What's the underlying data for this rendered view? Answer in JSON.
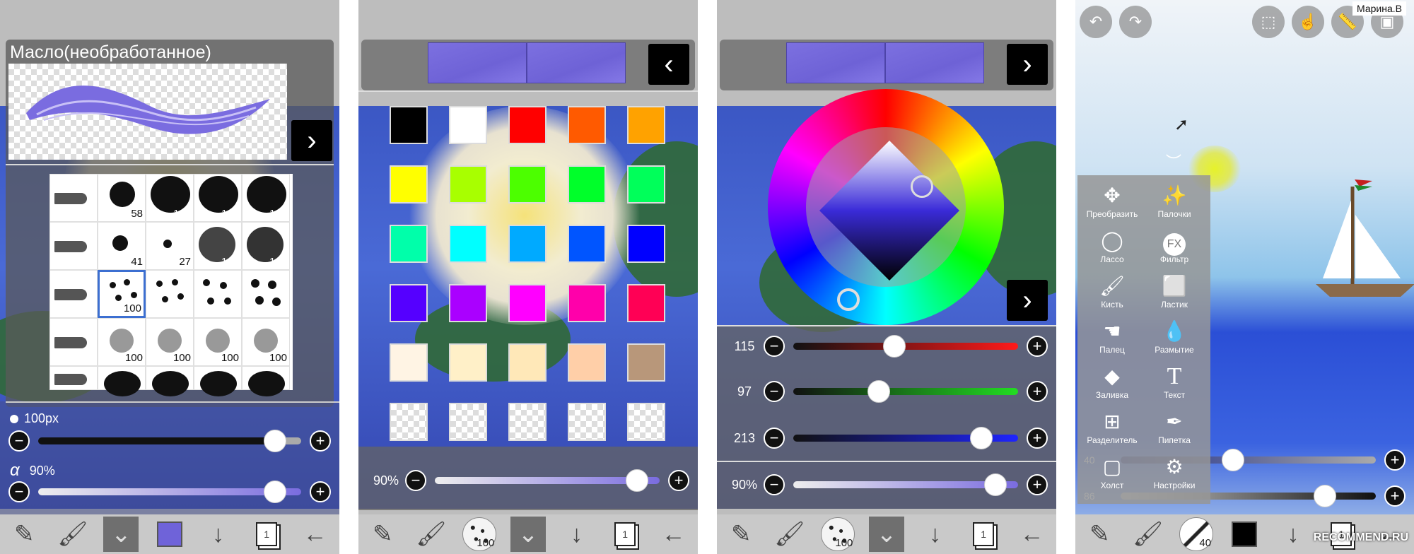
{
  "panel1": {
    "brush_name": "Масло(необработанное)",
    "grid_values": [
      [
        "",
        "58",
        "100",
        "100",
        "100"
      ],
      [
        "",
        "41",
        "27",
        "100",
        "100"
      ],
      [
        "",
        "100",
        "",
        "",
        ""
      ],
      [
        "",
        "100",
        "100",
        "100",
        "100"
      ],
      [
        "",
        "",
        "",
        "",
        ""
      ]
    ],
    "size_label": "100px",
    "size_value": 0.9,
    "alpha_symbol": "α",
    "alpha_label": "90%",
    "alpha_value": 0.9
  },
  "panel2": {
    "palette_colors": [
      "#000000",
      "#ffffff",
      "#ff0000",
      "#ff5a00",
      "#ffa200",
      "#ffff00",
      "#a8ff00",
      "#4cff00",
      "#00ff2a",
      "#00ff5a",
      "#00ffaa",
      "#00ffff",
      "#00aaff",
      "#0055ff",
      "#0000ff",
      "#5500ff",
      "#aa00ff",
      "#ff00ff",
      "#ff00aa",
      "#ff0055",
      "#fff4e4",
      "#fff0c8",
      "#ffe8b8",
      "#ffcfa8",
      "#b8977a"
    ],
    "opacity_label": "90%",
    "opacity_value": 0.9
  },
  "panel3": {
    "r_value": "115",
    "g_value": "97",
    "b_value": "213",
    "opacity_label": "90%",
    "opacity_value": 0.9
  },
  "panel4": {
    "user_name": "Марина.В",
    "watermark": "RECOMMEND.RU",
    "menu_items": [
      {
        "label": "Преобразить",
        "icon": "move-arrows-icon"
      },
      {
        "label": "Палочки",
        "icon": "magic-wand-icon"
      },
      {
        "label": "Лассо",
        "icon": "lasso-icon"
      },
      {
        "label": "Фильтр",
        "icon": "fx-icon"
      },
      {
        "label": "Кисть",
        "icon": "brush-icon"
      },
      {
        "label": "Ластик",
        "icon": "eraser-icon"
      },
      {
        "label": "Палец",
        "icon": "finger-icon"
      },
      {
        "label": "Размытие",
        "icon": "drop-icon"
      },
      {
        "label": "Заливка",
        "icon": "fill-icon"
      },
      {
        "label": "Текст",
        "icon": "text-icon"
      },
      {
        "label": "Разделитель",
        "icon": "divider-icon"
      },
      {
        "label": "Пипетка",
        "icon": "eyedropper-icon"
      },
      {
        "label": "Холст",
        "icon": "canvas-icon"
      },
      {
        "label": "Настройки",
        "icon": "gear-icon"
      }
    ],
    "fx_text": "FX",
    "text_icon_glyph": "T",
    "size_value_partial": "40",
    "alpha_value_partial": "86",
    "toolbar_brush_size": "40"
  },
  "toolbar": {
    "brush_thumb_value": "100",
    "layer_number": "1"
  }
}
